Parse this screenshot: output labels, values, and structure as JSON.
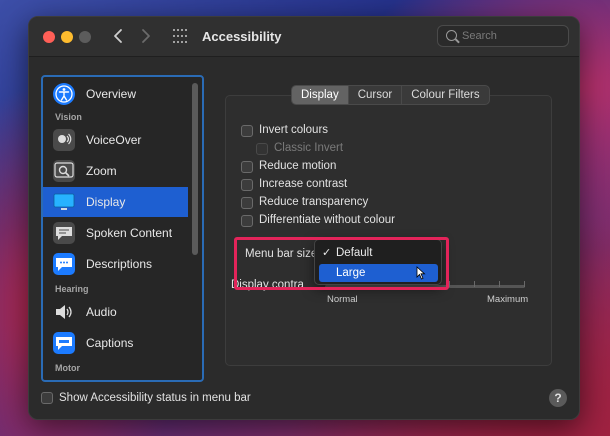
{
  "window": {
    "title": "Accessibility"
  },
  "search": {
    "placeholder": "Search"
  },
  "sidebar": {
    "items": [
      {
        "label": "Overview",
        "icon": "accessibility-person-icon"
      },
      {
        "label": "VoiceOver",
        "icon": "voiceover-icon"
      },
      {
        "label": "Zoom",
        "icon": "zoom-icon"
      },
      {
        "label": "Display",
        "icon": "display-icon",
        "selected": true
      },
      {
        "label": "Spoken Content",
        "icon": "speech-bubble-icon"
      },
      {
        "label": "Descriptions",
        "icon": "descriptions-icon"
      },
      {
        "label": "Audio",
        "icon": "speaker-icon"
      },
      {
        "label": "Captions",
        "icon": "captions-icon"
      }
    ],
    "headers": {
      "vision": "Vision",
      "hearing": "Hearing",
      "motor": "Motor"
    }
  },
  "tabs": [
    {
      "label": "Display",
      "active": true
    },
    {
      "label": "Cursor",
      "active": false
    },
    {
      "label": "Colour Filters",
      "active": false
    }
  ],
  "options": [
    {
      "label": "Invert colours",
      "checked": false,
      "disabled": false
    },
    {
      "label": "Classic Invert",
      "checked": false,
      "disabled": true
    },
    {
      "label": "Reduce motion",
      "checked": false,
      "disabled": false
    },
    {
      "label": "Increase contrast",
      "checked": false,
      "disabled": false
    },
    {
      "label": "Reduce transparency",
      "checked": false,
      "disabled": false
    },
    {
      "label": "Differentiate without colour",
      "checked": false,
      "disabled": false
    }
  ],
  "menu_bar_size": {
    "label": "Menu bar size",
    "options": [
      {
        "label": "Default",
        "checked": true,
        "check_mark": "✓"
      },
      {
        "label": "Large",
        "checked": false,
        "highlighted": true
      }
    ]
  },
  "display_contrast": {
    "label": "Display contra",
    "min_label": "Normal",
    "max_label": "Maximum"
  },
  "footer": {
    "status_label": "Show Accessibility status in menu bar",
    "help_label": "?"
  },
  "colors": {
    "accent": "#1e5fd1",
    "highlight_box": "#e3245a",
    "sidebar_border": "#2a6bb5"
  }
}
